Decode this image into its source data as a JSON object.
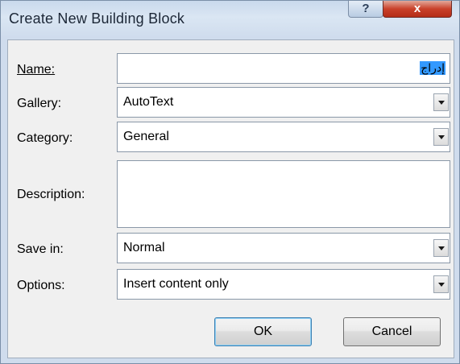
{
  "window": {
    "title": "Create New Building Block",
    "help_label": "?",
    "close_label": "x"
  },
  "form": {
    "name": {
      "label": "Name:",
      "value": "إدراج"
    },
    "gallery": {
      "label": "Gallery:",
      "value": "AutoText"
    },
    "category": {
      "label": "Category:",
      "value": "General"
    },
    "description": {
      "label": "Description:",
      "value": ""
    },
    "save_in": {
      "label": "Save in:",
      "value": "Normal"
    },
    "options": {
      "label": "Options:",
      "value": "Insert content only"
    }
  },
  "buttons": {
    "ok": "OK",
    "cancel": "Cancel"
  },
  "icons": {
    "dropdown": "chevron-down-icon",
    "help": "help-icon",
    "close": "close-icon"
  }
}
